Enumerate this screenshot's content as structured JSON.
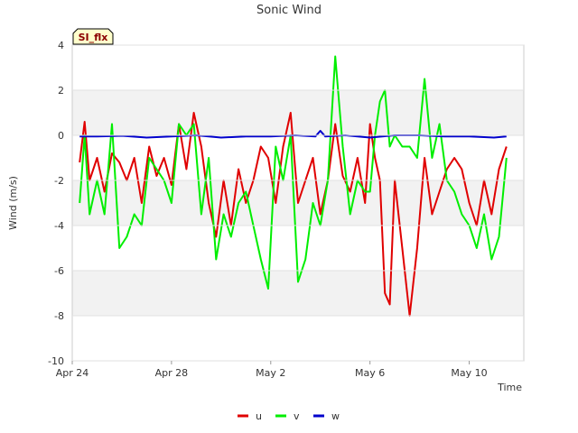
{
  "chart_data": {
    "type": "line",
    "title": "Sonic Wind",
    "xlabel": "Time",
    "ylabel": "Wind (m/s)",
    "site_label": "SI_flx",
    "x_start": "Apr 24",
    "x_end": "May 11",
    "xlim_days": [
      0,
      18.2
    ],
    "ylim": [
      -10,
      4
    ],
    "yticks": [
      -10,
      -8,
      -6,
      -4,
      -2,
      0,
      2,
      4
    ],
    "ytick_labels": [
      "-10",
      "-8",
      "-6",
      "-4",
      "-2",
      "0",
      "2",
      "4"
    ],
    "xtick_labels": [
      "Apr 24",
      "Apr 28",
      "May 2",
      "May 6",
      "May 10"
    ],
    "xtick_days": [
      0,
      4,
      8,
      12,
      16
    ],
    "grid": "horizontal-bands",
    "legend_position": "bottom-center",
    "series": [
      {
        "name": "u",
        "color": "#e00000",
        "x": [
          0.3,
          0.5,
          0.7,
          1.0,
          1.3,
          1.6,
          1.9,
          2.2,
          2.5,
          2.8,
          3.1,
          3.4,
          3.7,
          4.0,
          4.3,
          4.6,
          4.9,
          5.2,
          5.5,
          5.8,
          6.1,
          6.4,
          6.7,
          7.0,
          7.3,
          7.6,
          7.9,
          8.2,
          8.5,
          8.8,
          9.1,
          9.4,
          9.7,
          10.0,
          10.3,
          10.6,
          10.9,
          11.2,
          11.5,
          11.8,
          12.0,
          12.2,
          12.4,
          12.6,
          12.8,
          13.0,
          13.3,
          13.6,
          13.9,
          14.2,
          14.5,
          14.8,
          15.1,
          15.4,
          15.7,
          16.0,
          16.3,
          16.6,
          16.9,
          17.2,
          17.5
        ],
        "y": [
          -1.2,
          0.6,
          -2.0,
          -1.0,
          -2.5,
          -0.8,
          -1.2,
          -2.0,
          -1.0,
          -3.0,
          -0.5,
          -1.8,
          -1.0,
          -2.2,
          0.5,
          -1.5,
          1.0,
          -0.5,
          -3.0,
          -4.5,
          -2.0,
          -4.0,
          -1.5,
          -3.0,
          -2.0,
          -0.5,
          -1.0,
          -3.0,
          -0.5,
          1.0,
          -3.0,
          -2.0,
          -1.0,
          -3.5,
          -2.0,
          0.5,
          -1.8,
          -2.5,
          -1.0,
          -3.0,
          0.5,
          -1.0,
          -2.0,
          -7.0,
          -7.5,
          -2.0,
          -5.0,
          -8.0,
          -5.0,
          -1.0,
          -3.5,
          -2.5,
          -1.5,
          -1.0,
          -1.5,
          -3.0,
          -4.0,
          -2.0,
          -3.5,
          -1.5,
          -0.5
        ]
      },
      {
        "name": "v",
        "color": "#00ee00",
        "x": [
          0.3,
          0.5,
          0.7,
          1.0,
          1.3,
          1.6,
          1.9,
          2.2,
          2.5,
          2.8,
          3.1,
          3.4,
          3.7,
          4.0,
          4.3,
          4.6,
          4.9,
          5.2,
          5.5,
          5.8,
          6.1,
          6.4,
          6.7,
          7.0,
          7.3,
          7.6,
          7.9,
          8.2,
          8.5,
          8.8,
          9.1,
          9.4,
          9.7,
          10.0,
          10.3,
          10.6,
          10.9,
          11.2,
          11.5,
          11.8,
          12.0,
          12.2,
          12.4,
          12.6,
          12.8,
          13.0,
          13.3,
          13.6,
          13.9,
          14.2,
          14.5,
          14.8,
          15.1,
          15.4,
          15.7,
          16.0,
          16.3,
          16.6,
          16.9,
          17.2,
          17.5
        ],
        "y": [
          -3.0,
          0.0,
          -3.5,
          -2.0,
          -3.5,
          0.5,
          -5.0,
          -4.5,
          -3.5,
          -4.0,
          -1.0,
          -1.5,
          -2.0,
          -3.0,
          0.5,
          0.0,
          0.5,
          -3.5,
          -1.0,
          -5.5,
          -3.5,
          -4.5,
          -3.0,
          -2.5,
          -4.0,
          -5.5,
          -6.8,
          -0.5,
          -2.0,
          0.0,
          -6.5,
          -5.5,
          -3.0,
          -4.0,
          -2.0,
          3.5,
          -0.5,
          -3.5,
          -2.0,
          -2.5,
          -2.5,
          0.0,
          1.5,
          2.0,
          -0.5,
          0.0,
          -0.5,
          -0.5,
          -1.0,
          2.5,
          -1.0,
          0.5,
          -2.0,
          -2.5,
          -3.5,
          -4.0,
          -5.0,
          -3.5,
          -5.5,
          -4.5,
          -1.0
        ]
      },
      {
        "name": "w",
        "color": "#0000cc",
        "x": [
          0.3,
          1.0,
          2.0,
          3.0,
          4.0,
          5.0,
          6.0,
          7.0,
          8.0,
          9.0,
          9.8,
          10.0,
          10.2,
          11.0,
          12.0,
          13.0,
          14.0,
          15.0,
          16.0,
          17.0,
          17.5
        ],
        "y": [
          -0.05,
          -0.05,
          -0.02,
          -0.1,
          -0.05,
          0.0,
          -0.1,
          -0.05,
          -0.05,
          0.0,
          -0.05,
          0.2,
          -0.05,
          0.0,
          -0.1,
          0.0,
          0.0,
          -0.05,
          -0.05,
          -0.1,
          -0.05
        ]
      }
    ]
  }
}
